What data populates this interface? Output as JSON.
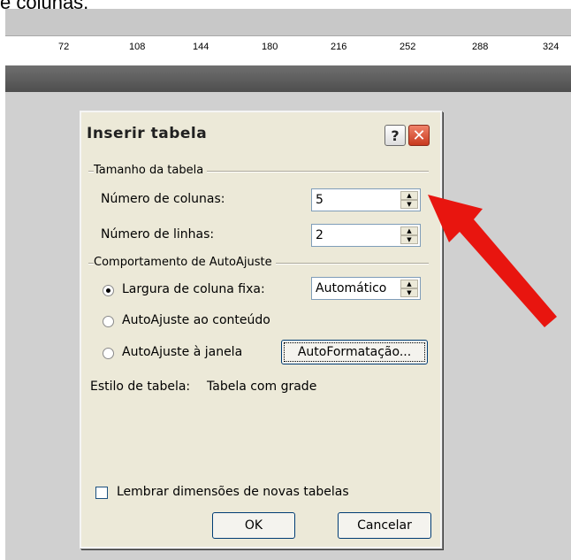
{
  "caption": "e colunas.",
  "ruler": {
    "marks": [
      "72",
      "108",
      "144",
      "180",
      "216",
      "252",
      "288",
      "324"
    ]
  },
  "dialog": {
    "title": "Inserir tabela",
    "help_glyph": "?",
    "close_glyph": "✕",
    "table_size": {
      "group_label": "Tamanho da tabela",
      "columns_label": "Número de colunas:",
      "columns_value": "5",
      "rows_label": "Número de linhas:",
      "rows_value": "2"
    },
    "autofit": {
      "group_label": "Comportamento de AutoAjuste",
      "fixed_width_label": "Largura de coluna fixa:",
      "fixed_width_value": "Automático",
      "fit_content_label": "AutoAjuste ao conteúdo",
      "fit_window_label": "AutoAjuste à janela",
      "autoformat_button": "AutoFormatação..."
    },
    "table_style_label": "Estilo de tabela:",
    "table_style_value": "Tabela com grade",
    "remember_label": "Lembrar dimensões de novas tabelas",
    "ok_button": "OK",
    "cancel_button": "Cancelar"
  },
  "colors": {
    "annotation_arrow": "#e8150f"
  }
}
